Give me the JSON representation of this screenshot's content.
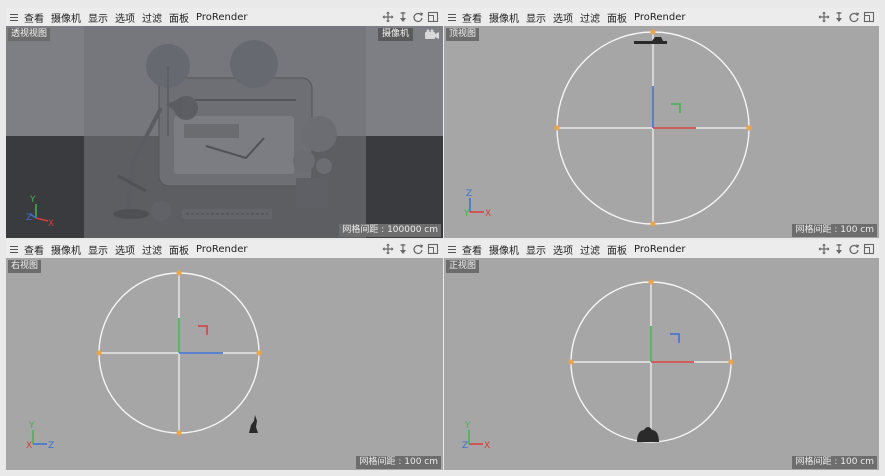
{
  "menubar": {
    "items": [
      "查看",
      "摄像机",
      "显示",
      "选项",
      "过滤",
      "面板",
      "ProRender"
    ]
  },
  "icons": {
    "menu": "hamburger-icon",
    "nav": [
      "move-view-icon",
      "dolly-view-icon",
      "rotate-view-icon",
      "maximize-view-icon"
    ]
  },
  "viewports": {
    "perspective": {
      "label": "透视视图",
      "camera_label": "摄像机",
      "grid_spacing": "网格间距 : 100000 cm",
      "axes": {
        "y": "Y",
        "z": "Z",
        "x": "X"
      }
    },
    "top": {
      "label": "顶视图",
      "grid_spacing": "网格间距 : 100 cm",
      "axes": {
        "z": "Z",
        "y": "Y",
        "x": "X"
      }
    },
    "right": {
      "label": "右视图",
      "grid_spacing": "网格间距 : 100 cm",
      "axes": {
        "y": "Y",
        "x": "X",
        "z": "Z"
      }
    },
    "front": {
      "label": "正视图",
      "grid_spacing": "网格间距 : 100 cm",
      "axes": {
        "y": "Y",
        "z": "Z",
        "x": "X"
      }
    }
  },
  "colors": {
    "axis_x": "#d83c3c",
    "axis_y": "#3cb84a",
    "axis_z": "#3a6fd6",
    "spline_point": "#f2a340",
    "viewport_bg": "#a6a6a6"
  }
}
